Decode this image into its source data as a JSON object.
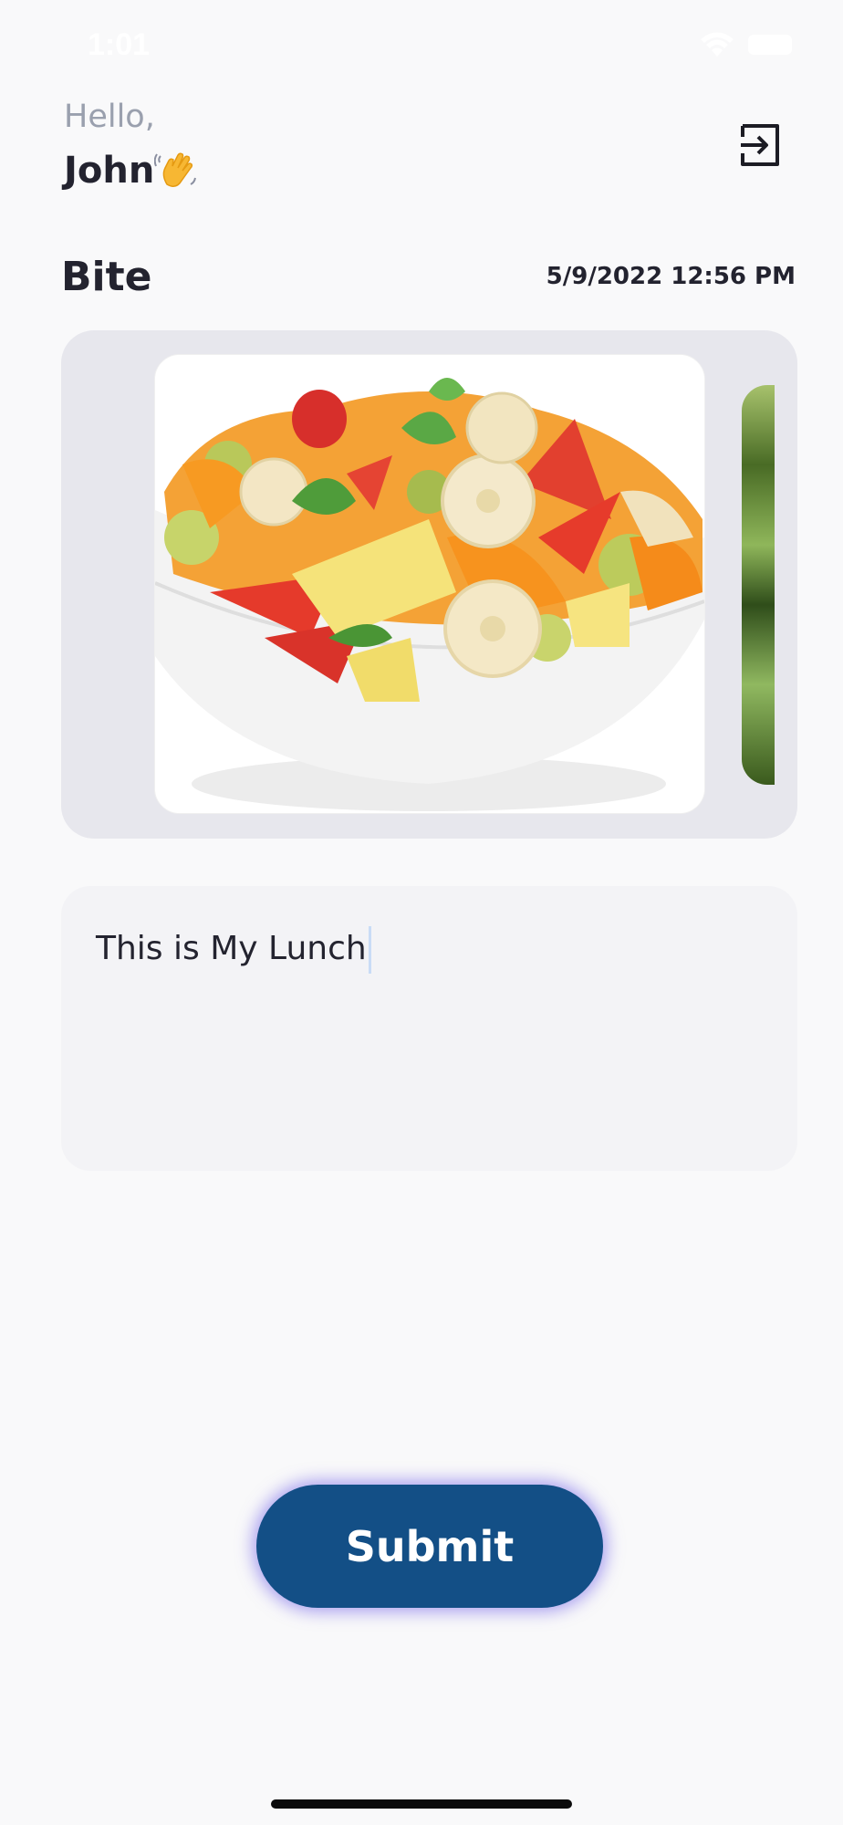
{
  "status_bar": {
    "time": "1:01",
    "wifi_icon": "wifi-icon",
    "battery_icon": "battery-icon"
  },
  "header": {
    "greeting": "Hello,",
    "user_name": "John",
    "wave_icon": "waving-hand-icon",
    "logout_icon": "logout-icon"
  },
  "section": {
    "title": "Bite",
    "datetime": "5/9/2022 12:56 PM"
  },
  "carousel": {
    "images": [
      {
        "name": "fruit-salad-bowl-image"
      },
      {
        "name": "green-leaves-image"
      }
    ]
  },
  "note": {
    "value": "This is My Lunch"
  },
  "actions": {
    "submit_label": "Submit"
  },
  "colors": {
    "background": "#f9f9fa",
    "primary": "#134f86",
    "button_glow": "#6250e6",
    "text_dark": "#23232f",
    "text_muted": "#9aa0ae",
    "carousel_bg": "#e7e7ed",
    "note_bg": "#f3f3f6"
  }
}
